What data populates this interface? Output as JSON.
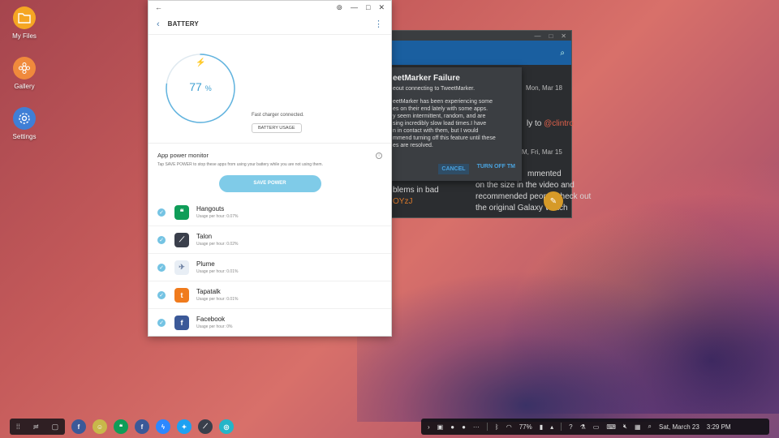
{
  "desktop": {
    "icons": [
      {
        "label": "My Files",
        "icon": "folder-icon",
        "color": "#f5a623"
      },
      {
        "label": "Gallery",
        "icon": "flower-icon",
        "color": "#f08a3c"
      },
      {
        "label": "Settings",
        "icon": "gear-icon",
        "color": "#3f7fd6"
      }
    ]
  },
  "background_window": {
    "dialog": {
      "title": "eetMarker Failure",
      "subtitle": "eout connecting to TweetMarker.",
      "body": "eetMarker has been experiencing some\nes on their end lately with some apps.\ny seem intermittent, random, and are\nsing incredibly slow load times.I have\nn in contact with them, but I would\nmmend turning off this feature until these\nes are resolved.",
      "cancel": "CANCEL",
      "confirm": "TURN OFF TM"
    },
    "snippets": {
      "date1": "Mon, Mar 18",
      "reply": "ly to",
      "handle": "@clintro",
      "date2": "M, Fri, Mar 15",
      "line1": "mmented",
      "line2": "on the size in the video and",
      "line3": "recommended people check out",
      "line4": "the original Galaxy Watch",
      "left1": "blems in bad",
      "left2": "OYzJ"
    }
  },
  "battery_window": {
    "header_title": "BATTERY",
    "percent": "77",
    "percent_unit": "%",
    "level": 0.77,
    "charger_status": "Fast charger connected.",
    "usage_button": "BATTERY USAGE",
    "monitor_title": "App power monitor",
    "monitor_desc": "Tap SAVE POWER to stop these apps from using your battery while you are not using them.",
    "save_button": "SAVE POWER",
    "apps": [
      {
        "name": "Hangouts",
        "usage": "Usage per hour: 0.07%",
        "icon": "hangouts-icon",
        "color": "#0f9d58",
        "glyph": "❝"
      },
      {
        "name": "Talon",
        "usage": "Usage per hour: 0.02%",
        "icon": "talon-icon",
        "color": "#3a3f4b",
        "glyph": "⟋"
      },
      {
        "name": "Plume",
        "usage": "Usage per hour: 0.01%",
        "icon": "plume-icon",
        "color": "#e8eef5",
        "glyph": "✈"
      },
      {
        "name": "Tapatalk",
        "usage": "Usage per hour: 0.01%",
        "icon": "tapatalk-icon",
        "color": "#f07b1d",
        "glyph": "t"
      },
      {
        "name": "Facebook",
        "usage": "Usage per hour: 0%",
        "icon": "facebook-icon",
        "color": "#3b5998",
        "glyph": "f"
      }
    ]
  },
  "taskbar": {
    "battery_percent": "77%",
    "date": "Sat, March 23",
    "time": "3:29 PM"
  }
}
